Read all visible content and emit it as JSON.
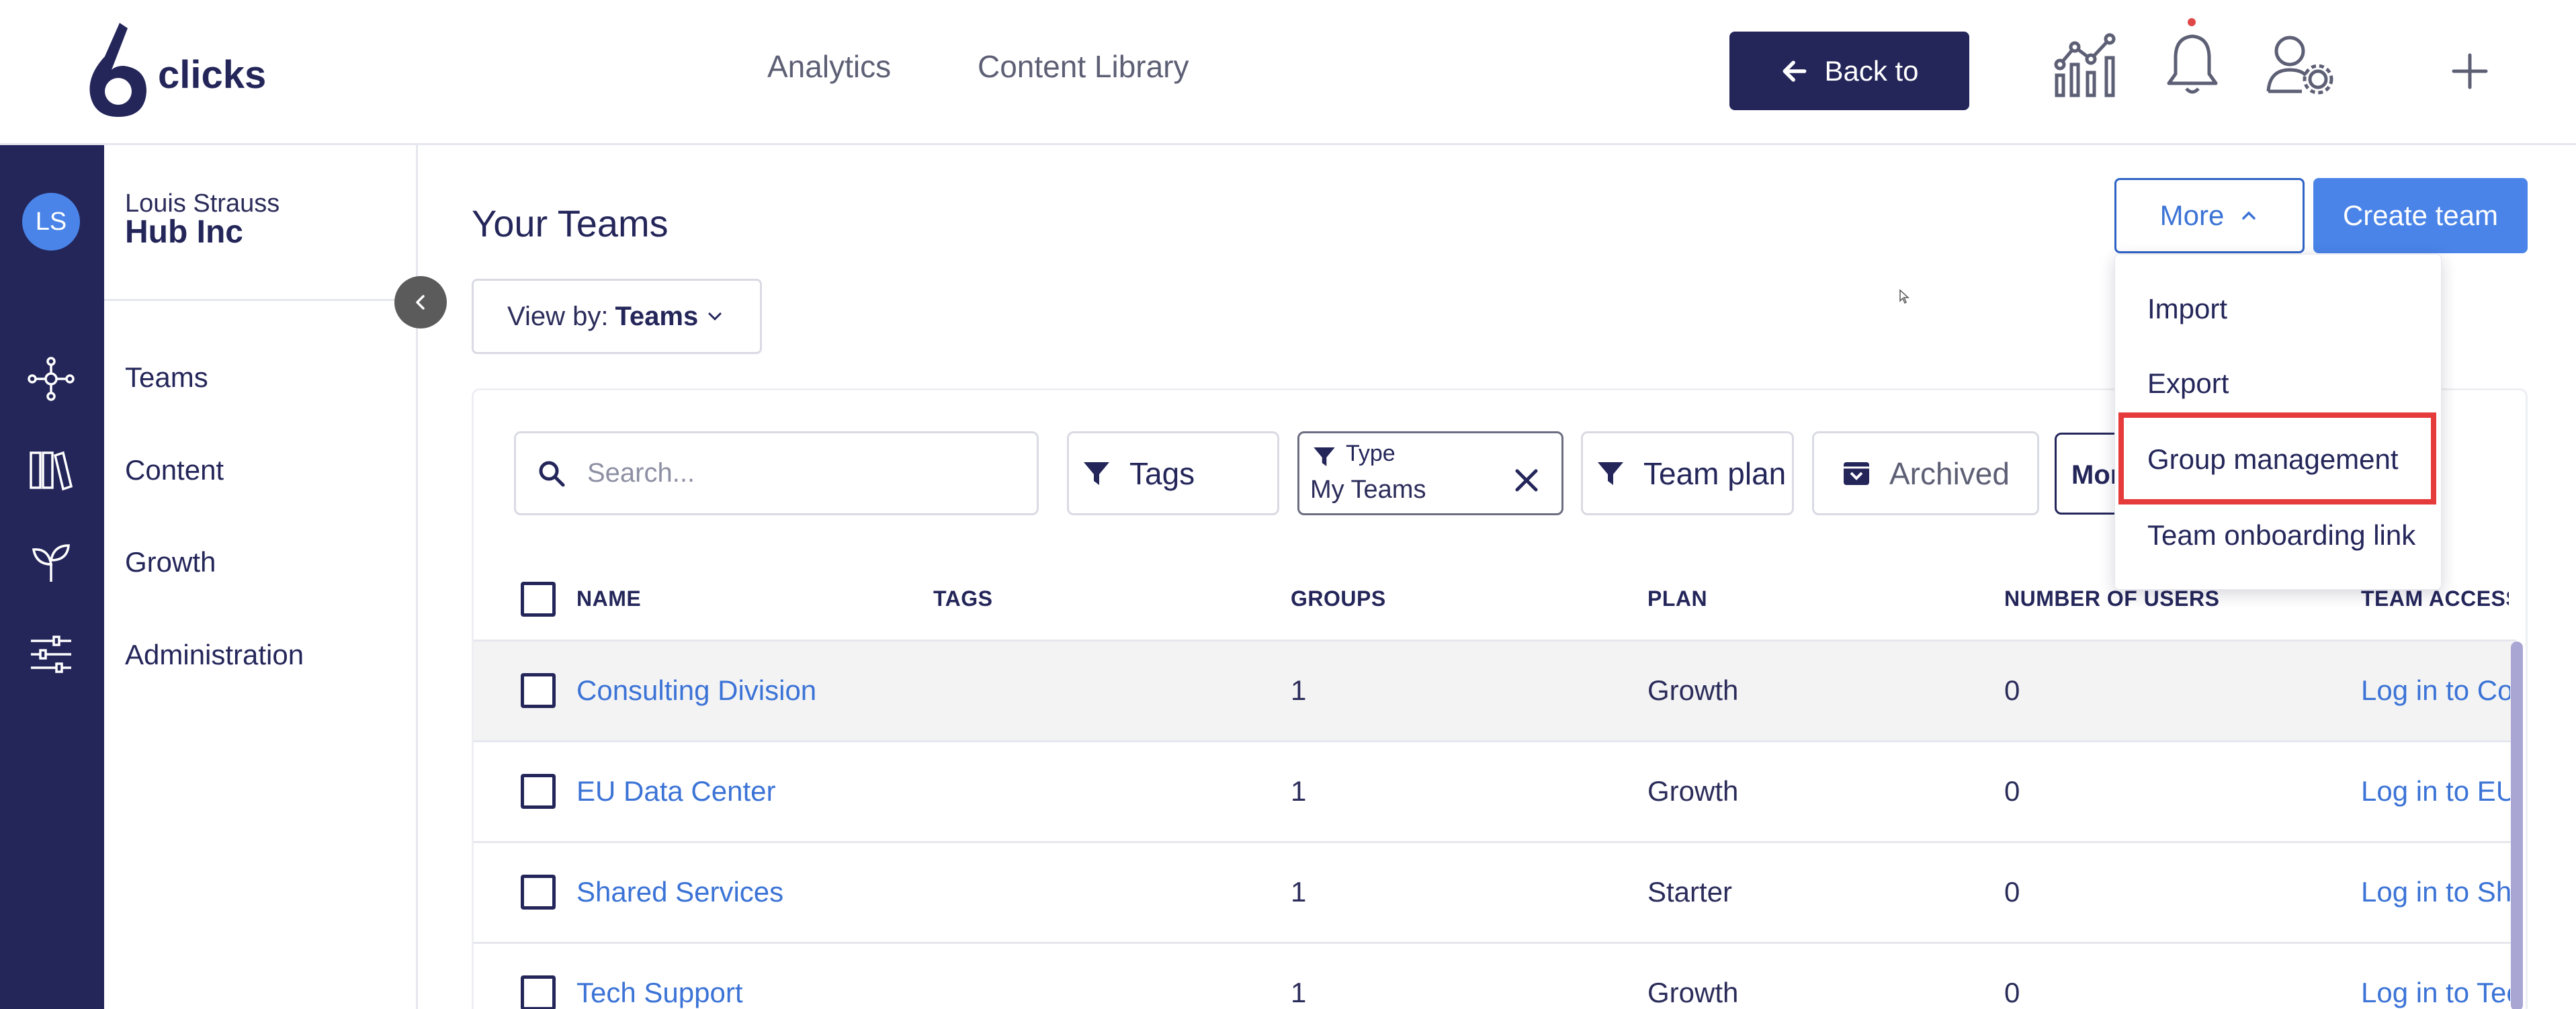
{
  "header": {
    "logo_text": "clicks",
    "nav": [
      "Analytics",
      "Content Library"
    ],
    "back_button": "Back to",
    "icons": [
      "analytics-icon",
      "bell-icon",
      "user-settings-icon",
      "plus-icon"
    ]
  },
  "user": {
    "initials": "LS",
    "name": "Louis Strauss",
    "org": "Hub Inc"
  },
  "sidebar": {
    "items": [
      {
        "label": "Teams",
        "icon": "network-icon"
      },
      {
        "label": "Content",
        "icon": "library-icon"
      },
      {
        "label": "Growth",
        "icon": "sprout-icon"
      },
      {
        "label": "Administration",
        "icon": "sliders-icon"
      }
    ]
  },
  "page": {
    "title": "Your Teams",
    "view_by_label": "View by:",
    "view_by_value": "Teams",
    "more_button": "More",
    "create_button": "Create team"
  },
  "filters": {
    "search_placeholder": "Search...",
    "tags": "Tags",
    "type_label": "Type",
    "type_value": "My Teams",
    "team_plan": "Team plan",
    "archived": "Archived",
    "more": "More"
  },
  "table": {
    "columns": [
      "NAME",
      "TAGS",
      "GROUPS",
      "PLAN",
      "NUMBER OF USERS",
      "TEAM ACCESS"
    ],
    "rows": [
      {
        "name": "Consulting Division",
        "tags": "",
        "groups": "1",
        "plan": "Growth",
        "users": "0",
        "access": "Log in to Consulting Division"
      },
      {
        "name": "EU Data Center",
        "tags": "",
        "groups": "1",
        "plan": "Growth",
        "users": "0",
        "access": "Log in to EU Data Center"
      },
      {
        "name": "Shared Services",
        "tags": "",
        "groups": "1",
        "plan": "Starter",
        "users": "0",
        "access": "Log in to Shared Services"
      },
      {
        "name": "Tech Support",
        "tags": "",
        "groups": "1",
        "plan": "Growth",
        "users": "0",
        "access": "Log in to Tech Support"
      }
    ]
  },
  "more_menu": {
    "items": [
      "Import",
      "Export",
      "Group management",
      "Team onboarding link"
    ],
    "highlighted": "Group management"
  },
  "colors": {
    "navy": "#24265a",
    "accent_blue": "#4a84e8",
    "link_blue": "#3b73d6",
    "highlight_red": "#e53b3b"
  }
}
